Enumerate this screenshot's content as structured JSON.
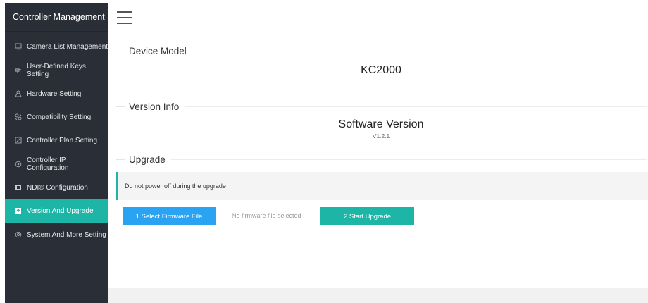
{
  "sidebar": {
    "title": "Controller Management",
    "items": [
      {
        "label": "Camera List Management",
        "icon": "camera-list-icon",
        "active": false
      },
      {
        "label": "User-Defined Keys Setting",
        "icon": "keys-icon",
        "active": false
      },
      {
        "label": "Hardware Setting",
        "icon": "hardware-icon",
        "active": false
      },
      {
        "label": "Compatibility Setting",
        "icon": "compatibility-icon",
        "active": false
      },
      {
        "label": "Controller Plan Setting",
        "icon": "plan-icon",
        "active": false
      },
      {
        "label": "Controller IP Configuration",
        "icon": "network-icon",
        "active": false
      },
      {
        "label": "NDI® Configuration",
        "icon": "ndi-icon",
        "active": false
      },
      {
        "label": "Version And Upgrade",
        "icon": "upgrade-icon",
        "active": true
      },
      {
        "label": "System And More Setting",
        "icon": "system-gear-icon",
        "active": false
      }
    ]
  },
  "header": {
    "menu_icon": "hamburger-menu-icon"
  },
  "device_model": {
    "section_label": "Device Model",
    "value": "KC2000"
  },
  "version_info": {
    "section_label": "Version Info",
    "name": "Software Version",
    "version": "V1.2.1"
  },
  "upgrade": {
    "section_label": "Upgrade",
    "notice": "Do not power off during the upgrade",
    "select_button": "1.Select Firmware File",
    "file_status": "No firmware file selected",
    "start_button": "2.Start Upgrade"
  },
  "colors": {
    "sidebar_bg": "#2a2f37",
    "accent_teal": "#1db5a6",
    "button_blue": "#29a3f2"
  }
}
